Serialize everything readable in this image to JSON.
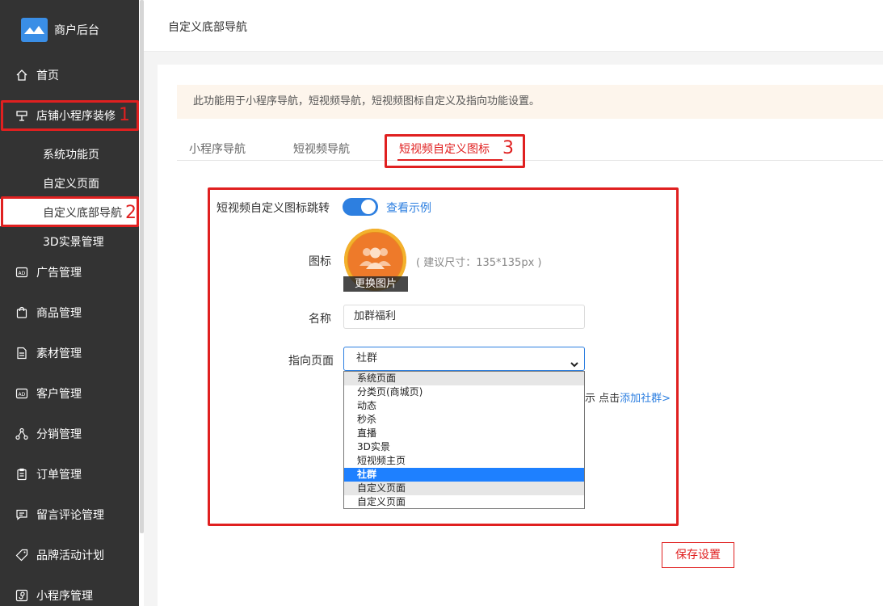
{
  "brand": {
    "name": "商户后台"
  },
  "sidebar": {
    "items": [
      {
        "label": "首页",
        "icon": "home-icon"
      },
      {
        "label": "店铺小程序装修",
        "icon": "shop-decoration-icon"
      },
      {
        "label": "广告管理",
        "icon": "ad-icon"
      },
      {
        "label": "商品管理",
        "icon": "shopping-bag-icon"
      },
      {
        "label": "素材管理",
        "icon": "document-icon"
      },
      {
        "label": "客户管理",
        "icon": "ad-icon"
      },
      {
        "label": "分销管理",
        "icon": "distribution-icon"
      },
      {
        "label": "订单管理",
        "icon": "clipboard-icon"
      },
      {
        "label": "留言评论管理",
        "icon": "comment-icon"
      },
      {
        "label": "品牌活动计划",
        "icon": "tag-icon"
      },
      {
        "label": "小程序管理",
        "icon": "miniprogram-icon"
      }
    ],
    "sub_items": [
      {
        "label": "系统功能页"
      },
      {
        "label": "自定义页面"
      },
      {
        "label": "自定义底部导航"
      },
      {
        "label": "3D实景管理"
      }
    ]
  },
  "annotations": {
    "n1": "1",
    "n2": "2",
    "n3": "3",
    "color": "#e02020"
  },
  "header": {
    "title": "自定义底部导航"
  },
  "notice": {
    "text": "此功能用于小程序导航，短视频导航，短视频图标自定义及指向功能设置。"
  },
  "tabs": [
    {
      "label": "小程序导航"
    },
    {
      "label": "短视频导航"
    },
    {
      "label": "短视频自定义图标"
    }
  ],
  "form": {
    "jump_label": "短视频自定义图标跳转",
    "jump_toggle_on": true,
    "example_link": "查看示例",
    "icon_label": "图标",
    "change_image": "更换图片",
    "icon_hint": "( 建议尺寸：135*135px )",
    "name_label": "名称",
    "name_value": "加群福利",
    "target_label": "指向页面",
    "target_value": "社群",
    "behind_text": "示 点击",
    "behind_link": "添加社群>",
    "options": [
      {
        "label": "系统页面",
        "state": "grey"
      },
      {
        "label": "分类页(商城页)",
        "state": ""
      },
      {
        "label": "动态",
        "state": ""
      },
      {
        "label": "秒杀",
        "state": ""
      },
      {
        "label": "直播",
        "state": ""
      },
      {
        "label": "3D实景",
        "state": ""
      },
      {
        "label": "短视频主页",
        "state": ""
      },
      {
        "label": "社群",
        "state": "selected"
      },
      {
        "label": "自定义页面",
        "state": "grey"
      },
      {
        "label": "自定义页面",
        "state": ""
      }
    ]
  },
  "actions": {
    "save": "保存设置"
  },
  "colors": {
    "accent": "#e02020",
    "primary": "#2d7fe0",
    "sidebar_bg": "#333333"
  }
}
